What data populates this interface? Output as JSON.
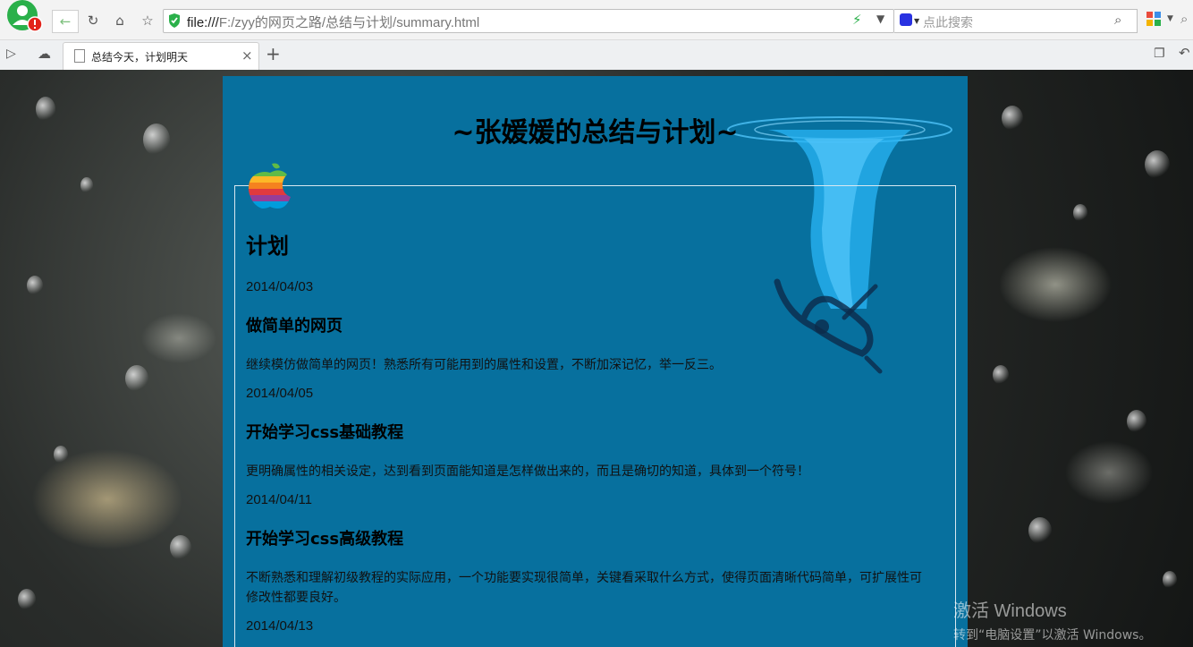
{
  "browser": {
    "url_scheme": "file:///",
    "url_path": "F:/zyy的网页之路/总结与计划/summary.html",
    "search_placeholder": "点此搜索",
    "tab_title": "总结今天，计划明天",
    "new_tab_label": "+",
    "tab_close": "×"
  },
  "page": {
    "title": "~张媛媛的总结与计划~",
    "heading": "计划",
    "entries": [
      {
        "date": "2014/04/03",
        "title": "做简单的网页",
        "text": "继续模仿做简单的网页！熟悉所有可能用到的属性和设置，不断加深记忆，举一反三。"
      },
      {
        "date": "2014/04/05",
        "title": "开始学习css基础教程",
        "text": "更明确属性的相关设定，达到看到页面能知道是怎样做出来的，而且是确切的知道，具体到一个符号！"
      },
      {
        "date": "2014/04/11",
        "title": "开始学习css高级教程",
        "text": "不断熟悉和理解初级教程的实际应用，一个功能要实现很简单，关键看采取什么方式，使得页面清晰代码简单，可扩展性可修改性都要良好。"
      },
      {
        "date": "2014/04/13"
      }
    ]
  },
  "watermark": {
    "line1": "激活 Windows",
    "line2": "转到“电脑设置”以激活 Windows。"
  },
  "colors": {
    "panel": "#07709e",
    "chrome": "#f3f3f3"
  }
}
